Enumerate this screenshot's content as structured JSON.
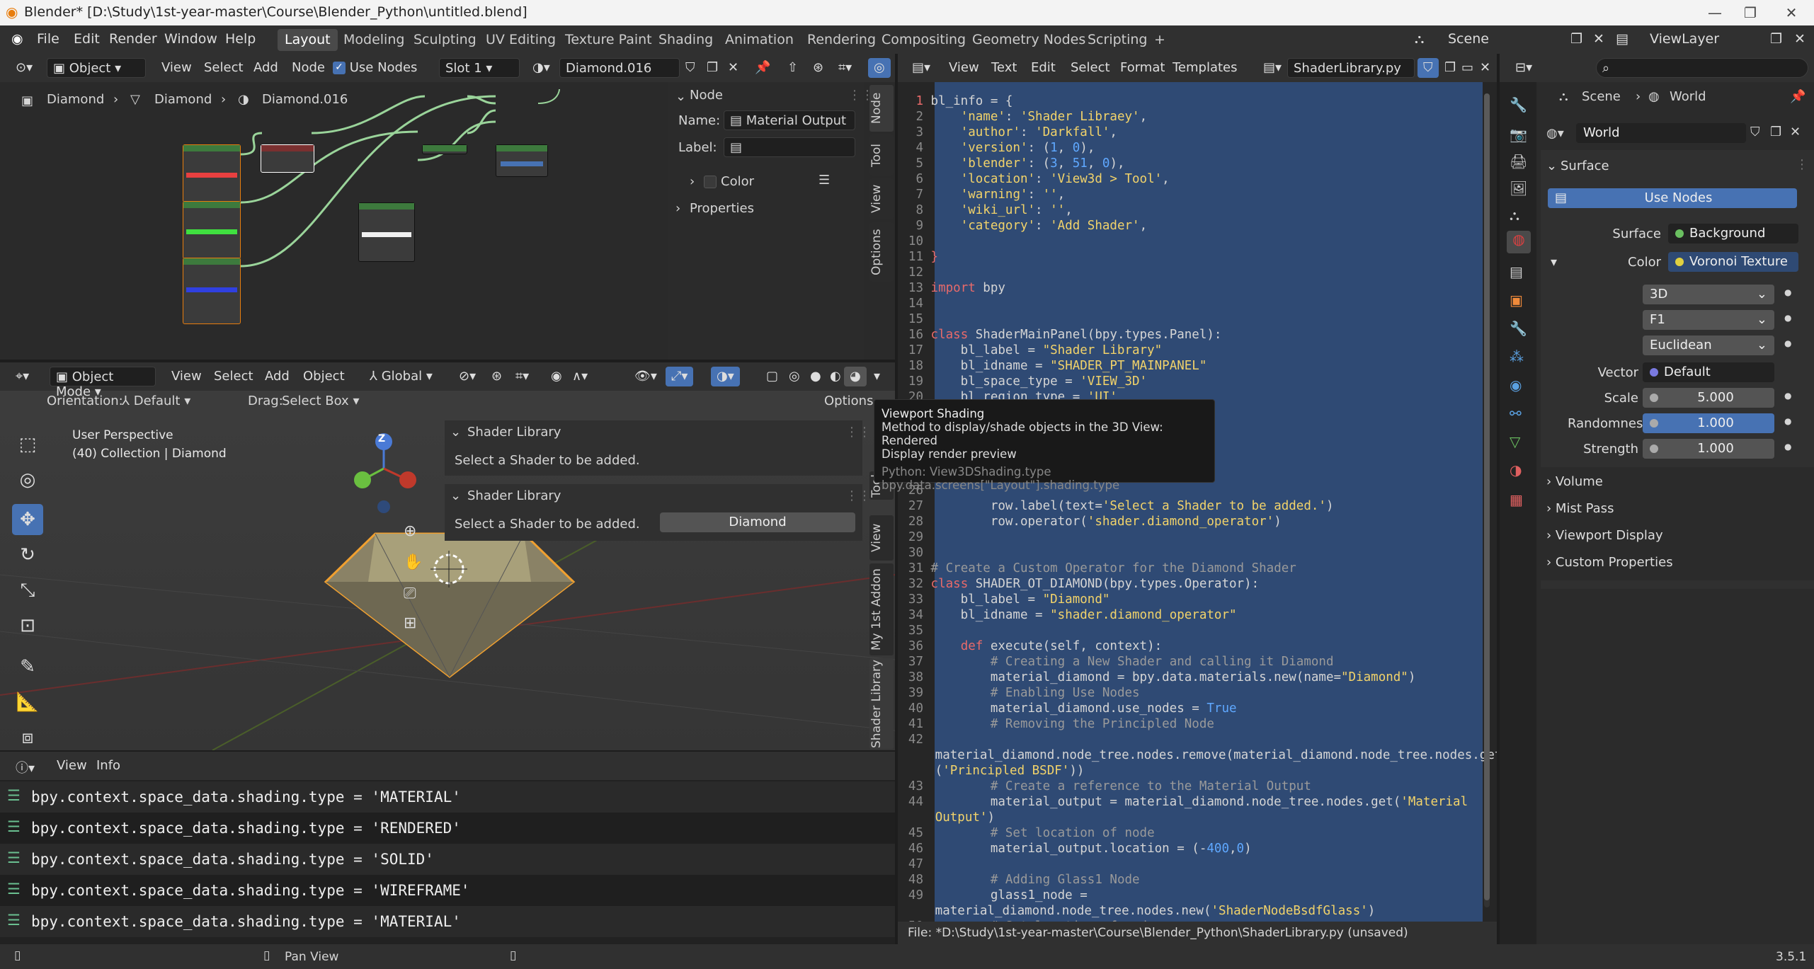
{
  "window": {
    "title": "Blender* [D:\\Study\\1st-year-master\\Course\\Blender_Python\\untitled.blend]",
    "min": "—",
    "max": "❐",
    "close": "✕"
  },
  "menu": [
    "File",
    "Edit",
    "Render",
    "Window",
    "Help"
  ],
  "workspaces": [
    "Layout",
    "Modeling",
    "Sculpting",
    "UV Editing",
    "Texture Paint",
    "Shading",
    "Animation",
    "Rendering",
    "Compositing",
    "Geometry Nodes",
    "Scripting",
    "+"
  ],
  "scene": "Scene",
  "viewlayer": "ViewLayer",
  "node_editor": {
    "mode": "Object",
    "menu": [
      "View",
      "Select",
      "Add",
      "Node"
    ],
    "use_nodes": "Use Nodes",
    "slot": "Slot 1",
    "material": "Diamond.016",
    "breadcrumb": [
      "Diamond",
      "Diamond",
      "Diamond.016"
    ],
    "sidebar": {
      "section": "Node",
      "name_label": "Name:",
      "name_value": "Material Output",
      "label_label": "Label:",
      "color": "Color",
      "properties": "Properties"
    },
    "tabs": [
      "Node",
      "Tool",
      "View",
      "Options"
    ]
  },
  "viewport": {
    "mode": "Object Mode",
    "menu": [
      "View",
      "Select",
      "Add",
      "Object"
    ],
    "transform": "Global",
    "orientation_label": "Orientation:",
    "orientation": "Default",
    "drag_label": "Drag:",
    "drag": "Select Box",
    "options": "Options",
    "persp": "User Perspective",
    "collection": "(40) Collection | Diamond",
    "panel1_title": "Shader Library",
    "panel1_text": "Select a Shader to be added.",
    "panel2_title": "Shader Library",
    "panel2_text": "Select a Shader to be added.",
    "panel2_button": "Diamond",
    "tabs": [
      "Tool",
      "View",
      "My 1st Addon",
      "Shader Library"
    ],
    "axis_z": "Z"
  },
  "tooltip": {
    "title": "Viewport Shading",
    "line1": "Method to display/shade objects in the 3D View:",
    "line1b": "Rendered",
    "line2": "Display render preview",
    "py1": "Python: View3DShading.type",
    "py2": "bpy.data.screens[\"Layout\"].shading.type"
  },
  "console": {
    "menu": [
      "View",
      "Info"
    ],
    "lines": [
      "bpy.context.space_data.shading.type = 'MATERIAL'",
      "bpy.context.space_data.shading.type = 'RENDERED'",
      "bpy.context.space_data.shading.type = 'SOLID'",
      "bpy.context.space_data.shading.type = 'WIREFRAME'",
      "bpy.context.space_data.shading.type = 'MATERIAL'"
    ]
  },
  "text_editor": {
    "menu": [
      "View",
      "Text",
      "Edit",
      "Select",
      "Format",
      "Templates"
    ],
    "file": "ShaderLibrary.py",
    "footer": "File: *D:\\Study\\1st-year-master\\Course\\Blender_Python\\ShaderLibrary.py (unsaved)"
  },
  "properties": {
    "breadcrumb": [
      "Scene",
      "World"
    ],
    "world": "World",
    "surface": "Surface",
    "use_nodes": "Use Nodes",
    "surface_label": "Surface",
    "surface_value": "Background",
    "color_label": "Color",
    "color_value": "Voronoi Texture",
    "dim": "3D",
    "feature": "F1",
    "metric": "Euclidean",
    "vector_label": "Vector",
    "vector_value": "Default",
    "scale_label": "Scale",
    "scale_value": "5.000",
    "rand_label": "Randomness",
    "rand_value": "1.000",
    "strength_label": "Strength",
    "strength_value": "1.000",
    "sections": [
      "Volume",
      "Mist Pass",
      "Viewport Display",
      "Custom Properties"
    ]
  },
  "status": {
    "pan": "Pan View",
    "version": "3.5.1"
  },
  "colors": {
    "accent": "#4772b3",
    "selection": "#2f4a74"
  }
}
